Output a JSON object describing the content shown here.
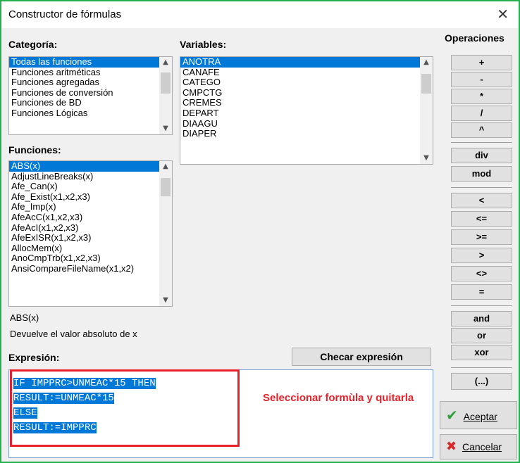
{
  "window": {
    "title": "Constructor de fórmulas",
    "close_glyph": "✕"
  },
  "categoria": {
    "label": "Categoría:",
    "items": [
      "Todas las funciones",
      "Funciones aritméticas",
      "Funciones agregadas",
      "Funciones de conversión",
      "Funciones de BD",
      "Funciones Lógicas"
    ]
  },
  "variables": {
    "label": "Variables:",
    "items": [
      "ANOTRA",
      "CANAFE",
      "CATEGO",
      "CMPCTG",
      "CREMES",
      "DEPART",
      "DIAAGU",
      "DIAPER"
    ]
  },
  "funciones": {
    "label": "Funciones:",
    "items": [
      "ABS(x)",
      "AdjustLineBreaks(x)",
      "Afe_Can(x)",
      "Afe_Exist(x1,x2,x3)",
      "Afe_Imp(x)",
      "AfeAcC(x1,x2,x3)",
      "AfeAcI(x1,x2,x3)",
      "AfeExISR(x1,x2,x3)",
      "AllocMem(x)",
      "AnoCmpTrb(x1,x2,x3)",
      "AnsiCompareFileName(x1,x2)"
    ]
  },
  "funcion_info": {
    "signature": "ABS(x)",
    "description": "Devuelve el valor absoluto de x"
  },
  "operaciones": {
    "label": "Operaciones",
    "group1": [
      "+",
      "-",
      "*",
      "/",
      "^"
    ],
    "group2": [
      "div",
      "mod"
    ],
    "group3": [
      "<",
      "<=",
      ">=",
      ">",
      "<>",
      "="
    ],
    "group4": [
      "and",
      "or",
      "xor"
    ],
    "group5": [
      "(...)"
    ]
  },
  "expresion": {
    "label": "Expresión:",
    "check_button": "Checar expresión",
    "lines": [
      "IF IMPPRC>UNMEAC*15 THEN",
      "RESULT:=UNMEAC*15",
      "ELSE",
      "RESULT:=IMPPRC"
    ]
  },
  "annotation": {
    "text": "Seleccionar formùla y quitarla"
  },
  "dialog_buttons": {
    "accept_icon": "✔",
    "accept_label": "Aceptar",
    "cancel_icon": "✖",
    "cancel_label": "Cancelar"
  },
  "colors": {
    "selection": "#0078d7",
    "frame": "#23b14d",
    "annotation": "#e8202a"
  }
}
